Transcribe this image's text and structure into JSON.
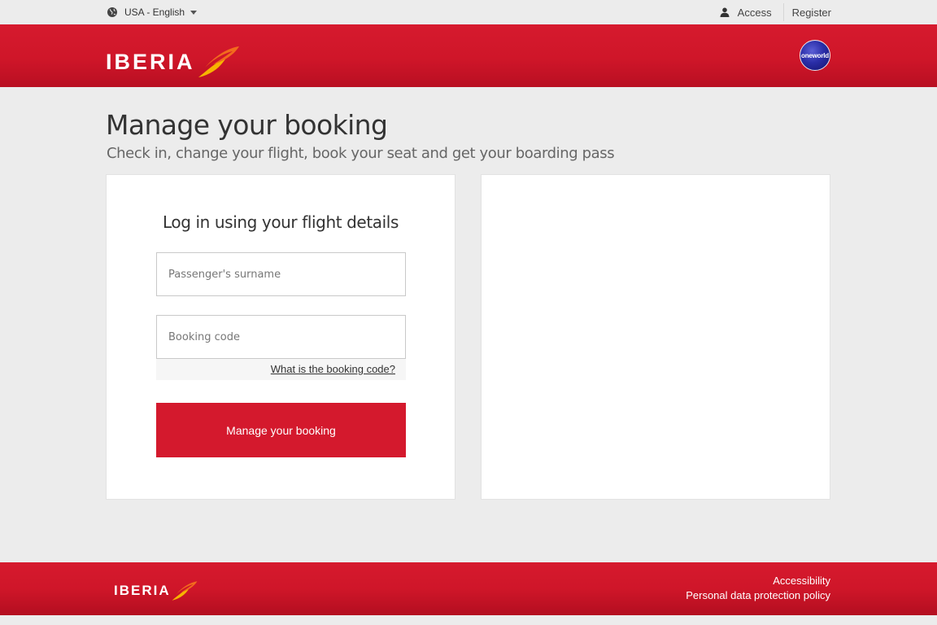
{
  "topbar": {
    "language": "USA - English",
    "access_label": "Access",
    "register_label": "Register"
  },
  "header": {
    "logo_text": "IBERIA",
    "alliance_badge": "oneworld"
  },
  "main": {
    "title": "Manage your booking",
    "subtitle": "Check in, change your flight, book your seat and get your boarding pass",
    "login_form": {
      "title": "Log in using your flight details",
      "surname_placeholder": "Passenger's surname",
      "surname_value": "",
      "booking_code_placeholder": "Booking code",
      "booking_code_value": "",
      "help_link": "What is the booking code?",
      "submit_label": "Manage your booking"
    }
  },
  "footer": {
    "logo_text": "IBERIA",
    "links": [
      "Accessibility",
      "Personal data protection policy"
    ]
  },
  "colors": {
    "brand_red": "#d4192d",
    "logo_yellow": "#f7b500",
    "logo_orange": "#f26b1d",
    "oneworld_blue": "#2a2ea8"
  },
  "icons": [
    "globe-icon",
    "caret-down-icon",
    "user-icon",
    "iberia-logo-mark",
    "oneworld-logo"
  ]
}
